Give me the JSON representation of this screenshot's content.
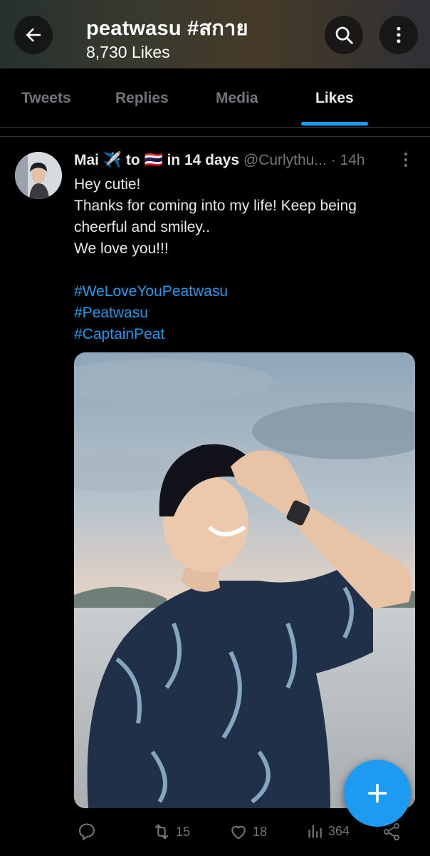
{
  "header": {
    "title": "peatwasu #สกาย",
    "likes_count": "8,730 Likes",
    "icons": [
      "back-arrow-icon",
      "search-icon",
      "more-vertical-icon"
    ]
  },
  "tabs": [
    {
      "label": "Tweets",
      "active": false
    },
    {
      "label": "Replies",
      "active": false
    },
    {
      "label": "Media",
      "active": false
    },
    {
      "label": "Likes",
      "active": true
    }
  ],
  "tweet": {
    "name": "Mai ✈️ to 🇹🇭 in 14 days",
    "handle": "@Curlythu...",
    "time": "· 14h",
    "lines": [
      "Hey cutie!",
      "Thanks for coming into my life! Keep being cheerful and smiley..",
      "We love you!!!"
    ],
    "hashtags": [
      "#WeLoveYouPeatwasu",
      "#Peatwasu",
      "#CaptainPeat"
    ],
    "stats": {
      "replies": "",
      "retweets": "15",
      "likes": "18",
      "views": "364"
    }
  },
  "colors": {
    "accent": "#1d9bf0",
    "background": "#000000",
    "muted_text": "#71767b"
  }
}
